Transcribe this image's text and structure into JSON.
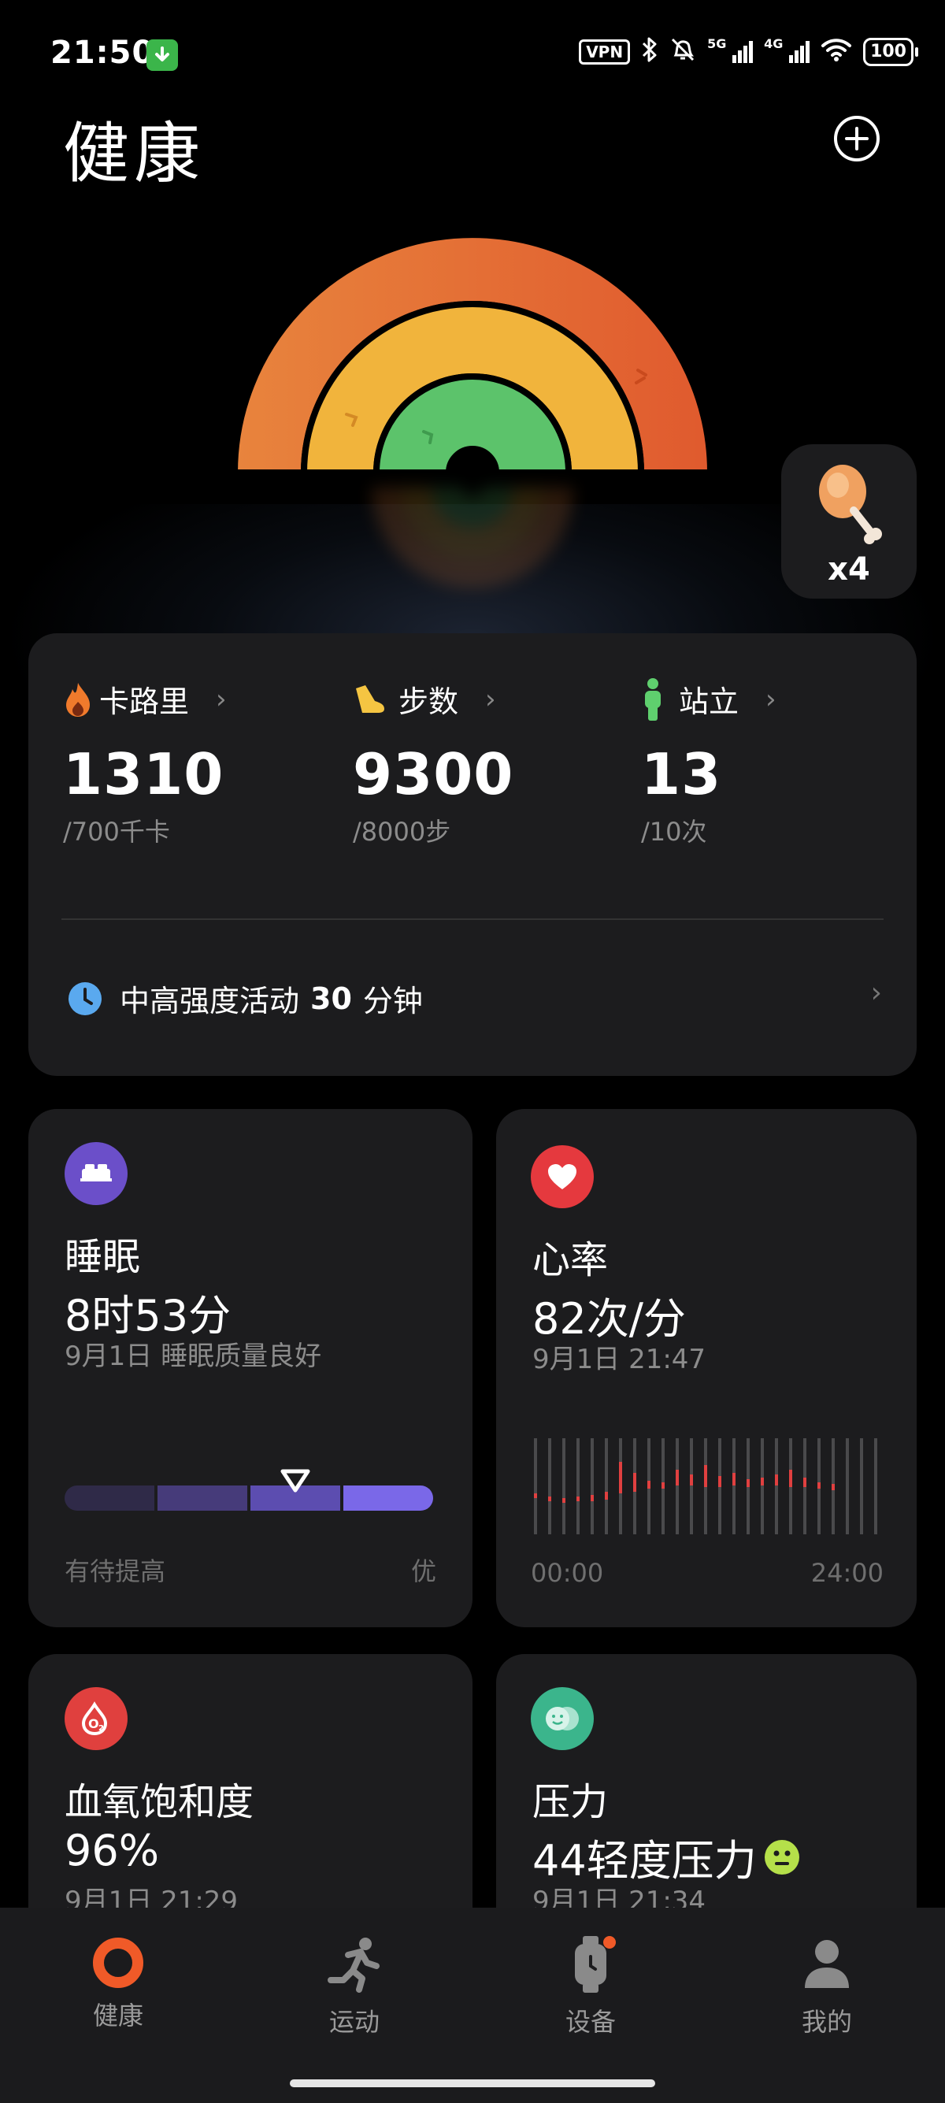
{
  "status_bar": {
    "time": "21:50",
    "vpn": "VPN",
    "signal1": "5G",
    "signal2": "4G",
    "battery": "100"
  },
  "header": {
    "title": "健康"
  },
  "reward": {
    "count": "x4"
  },
  "activity": {
    "calories": {
      "label": "卡路里",
      "value": "1310",
      "goal": "/700千卡",
      "color": "#f07a2c"
    },
    "steps": {
      "label": "步数",
      "value": "9300",
      "goal": "/8000步",
      "color": "#f5c542"
    },
    "stand": {
      "label": "站立",
      "value": "13",
      "goal": "/10次",
      "color": "#5fcf6e"
    },
    "intensity": {
      "prefix": "中高强度活动",
      "minutes": "30",
      "unit": "分钟"
    }
  },
  "sleep": {
    "title": "睡眠",
    "value": "8时53分",
    "sub": "9月1日 睡眠质量良好",
    "low_label": "有待提高",
    "high_label": "优",
    "level": 0.625
  },
  "heart": {
    "title": "心率",
    "value": "82次/分",
    "sub": "9月1日 21:47",
    "start": "00:00",
    "end": "24:00"
  },
  "spo2": {
    "title": "血氧饱和度",
    "value": "96%",
    "sub": "9月1日 21:29"
  },
  "stress": {
    "title": "压力",
    "value": "44轻度压力",
    "sub": "9月1日 21:34"
  },
  "nav": {
    "items": [
      {
        "label": "健康"
      },
      {
        "label": "运动"
      },
      {
        "label": "设备"
      },
      {
        "label": "我的"
      }
    ]
  }
}
